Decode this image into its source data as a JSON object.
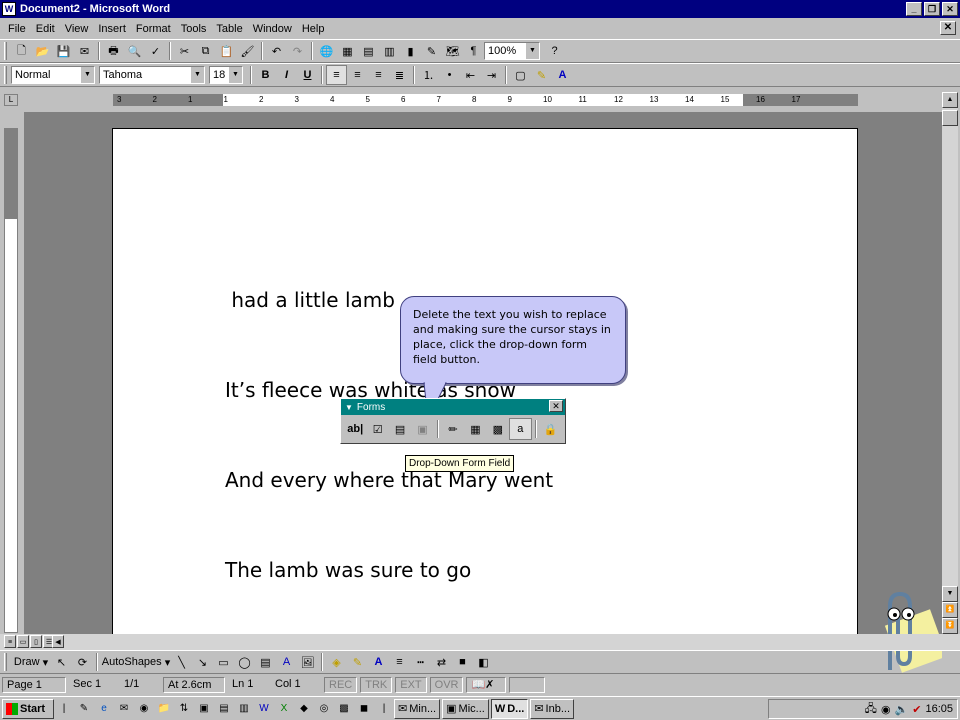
{
  "window": {
    "title": "Document2 - Microsoft Word"
  },
  "menu": [
    {
      "label": "File"
    },
    {
      "label": "Edit"
    },
    {
      "label": "View"
    },
    {
      "label": "Insert"
    },
    {
      "label": "Format"
    },
    {
      "label": "Tools"
    },
    {
      "label": "Table"
    },
    {
      "label": "Window"
    },
    {
      "label": "Help"
    }
  ],
  "standard_toolbar": {
    "zoom": "100%"
  },
  "formatting_toolbar": {
    "style": "Normal",
    "font": "Tahoma",
    "size": "18",
    "bold": "B",
    "italic": "I",
    "underline": "U",
    "font_color_letter": "A"
  },
  "document": {
    "lines": [
      " had a little lamb",
      "It’s fleece was white as snow",
      "And every where that Mary went",
      "The lamb was sure to go"
    ]
  },
  "callout": {
    "text": "Delete the text you wish to replace and making sure the cursor stays in place, click the drop-down form field button."
  },
  "forms_toolbar": {
    "title": "Forms",
    "text_field_label": "ab|"
  },
  "tooltip": "Drop-Down Form Field",
  "drawing_toolbar": {
    "draw": "Draw",
    "autoshapes": "AutoShapes"
  },
  "status": {
    "page": "Page 1",
    "sec": "Sec 1",
    "pages": "1/1",
    "at": "At 2.6cm",
    "ln": "Ln 1",
    "col": "Col 1",
    "rec": "REC",
    "trk": "TRK",
    "ext": "EXT",
    "ovr": "OVR"
  },
  "taskbar": {
    "start": "Start",
    "tasks": [
      {
        "label": "Min..."
      },
      {
        "label": "Mic..."
      },
      {
        "label": "D..."
      },
      {
        "label": "Inb..."
      }
    ],
    "clock": "16:05"
  },
  "ruler_numbers": [
    "3",
    "2",
    "1",
    "1",
    "2",
    "3",
    "4",
    "5",
    "6",
    "7",
    "8",
    "9",
    "10",
    "11",
    "12",
    "13",
    "14",
    "15",
    "16",
    "17"
  ]
}
